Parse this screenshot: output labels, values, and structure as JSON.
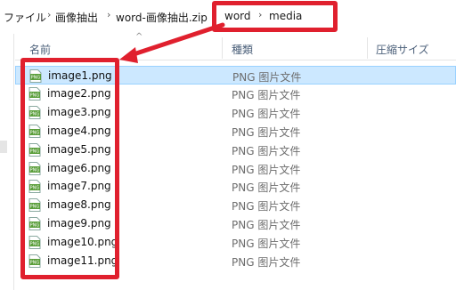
{
  "breadcrumb": {
    "items": [
      "ファイル",
      "画像抽出",
      "word-画像抽出.zip",
      "word",
      "media"
    ],
    "separator": "›"
  },
  "columns": {
    "name": "名前",
    "type": "種類",
    "compressed_size": "圧縮サイズ"
  },
  "files": [
    {
      "name": "image1.png",
      "type": "PNG 图片文件",
      "selected": true
    },
    {
      "name": "image2.png",
      "type": "PNG 图片文件",
      "selected": false
    },
    {
      "name": "image3.png",
      "type": "PNG 图片文件",
      "selected": false
    },
    {
      "name": "image4.png",
      "type": "PNG 图片文件",
      "selected": false
    },
    {
      "name": "image5.png",
      "type": "PNG 图片文件",
      "selected": false
    },
    {
      "name": "image6.png",
      "type": "PNG 图片文件",
      "selected": false
    },
    {
      "name": "image7.png",
      "type": "PNG 图片文件",
      "selected": false
    },
    {
      "name": "image8.png",
      "type": "PNG 图片文件",
      "selected": false
    },
    {
      "name": "image9.png",
      "type": "PNG 图片文件",
      "selected": false
    },
    {
      "name": "image10.png",
      "type": "PNG 图片文件",
      "selected": false
    },
    {
      "name": "image11.png",
      "type": "PNG 图片文件",
      "selected": false
    }
  ],
  "icons": {
    "file": "png-file-icon",
    "sort": "sort-ascending-icon"
  },
  "colors": {
    "highlight": "#e0202e",
    "selection": "#cce8ff",
    "icon_green": "#5a9e3a"
  }
}
